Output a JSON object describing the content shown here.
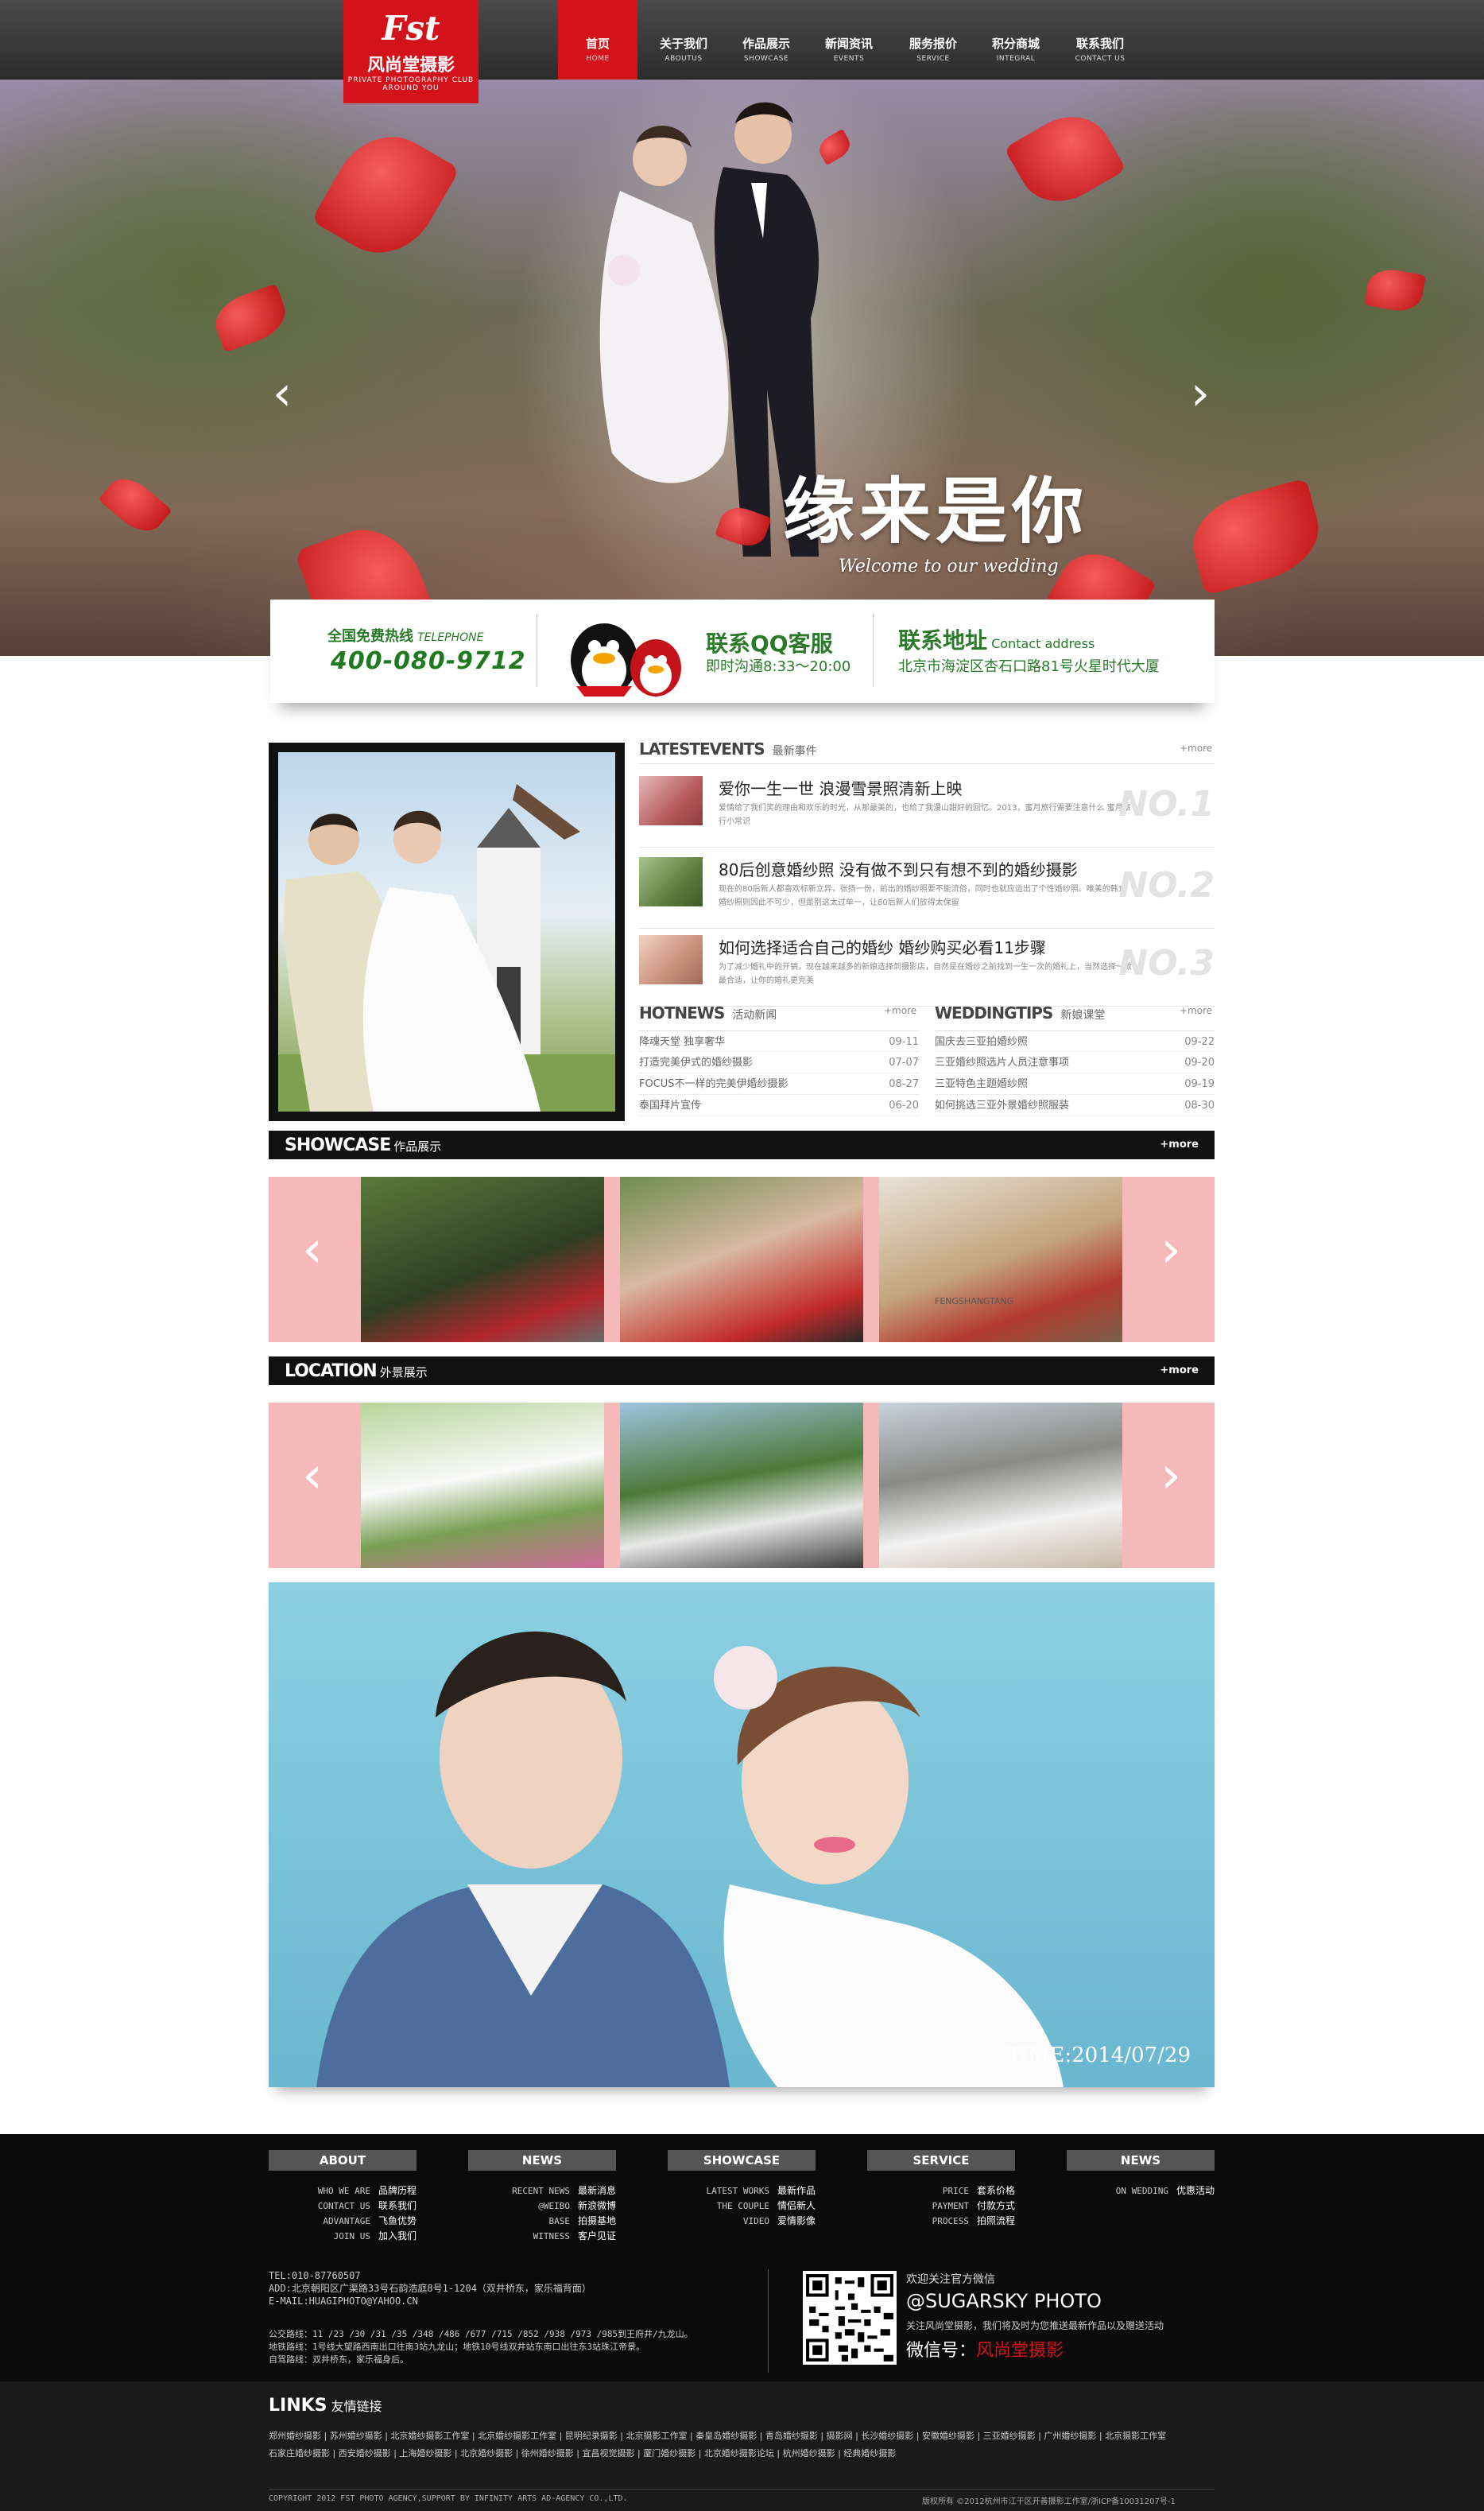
{
  "logo": {
    "brand": "Fst",
    "name": "风尚堂摄影",
    "tag1": "PRIVATE PHOTOGRAPHY CLUB",
    "tag2": "AROUND YOU"
  },
  "nav": [
    {
      "cn": "首页",
      "en": "HOME"
    },
    {
      "cn": "关于我们",
      "en": "ABOUTUS"
    },
    {
      "cn": "作品展示",
      "en": "SHOWCASE"
    },
    {
      "cn": "新闻资讯",
      "en": "EVENTS"
    },
    {
      "cn": "服务报价",
      "en": "SERVICE"
    },
    {
      "cn": "积分商城",
      "en": "INTEGRAL"
    },
    {
      "cn": "联系我们",
      "en": "CONTACT US"
    }
  ],
  "hero": {
    "script": "缘来是你",
    "sub": "Welcome to our wedding",
    "prev": "‹",
    "next": "›"
  },
  "contact": {
    "hotline_title": "全国免费热线",
    "hotline_en": "TELEPHONE",
    "phone": "400-080-9712",
    "qq_title": "联系QQ客服",
    "qq_hours": "即时沟通8:33～20:00",
    "addr_title": "联系地址",
    "addr_en": "Contact address",
    "addr": "北京市海淀区杏石口路81号火星时代大厦"
  },
  "latest": {
    "title": "LATESTEVENTS",
    "sub": "最新事件",
    "more": "+more",
    "items": [
      {
        "t": "爱你一生一世 浪漫雪景照清新上映",
        "d": "爱情给了我们笑的理由和欢乐的时光，从那最美的，也给了我漫山甜好的回忆。2013，蜜月旅行需要注意什么 蜜月旅行小常识",
        "no": "NO.1"
      },
      {
        "t": "80后创意婚纱照 没有做不到只有想不到的婚纱摄影",
        "d": "现在的80后新人都喜欢标新立异，张扬一份，前出的婚纱照要不能流俗，同时也就应运出了个性婚纱照。唯美的韩式婚纱照则因此不可少，但是别这太过单一，让80后新人们放得太保留",
        "no": "NO.2"
      },
      {
        "t": "如何选择适合自己的婚纱 婚纱购买必看11步骤",
        "d": "为了减少婚礼中的开销，现在越来越多的新娘选择到摄影店，自然是在婚纱之前找到一生一次的婚礼上，当然选择一款最合适，让你的婚礼更完美",
        "no": "NO.3"
      }
    ]
  },
  "hotnews": {
    "title": "HOTNEWS",
    "sub": "活动新闻",
    "more": "+more",
    "rows": [
      {
        "t": "降魂天堂 独享奢华",
        "d": "09-11"
      },
      {
        "t": "打造完美伊式的婚纱摄影",
        "d": "07-07"
      },
      {
        "t": "FOCUS不一样的完美伊婚纱摄影",
        "d": "08-27"
      },
      {
        "t": "泰国拜片宣传",
        "d": "06-20"
      }
    ]
  },
  "tips": {
    "title": "WEDDINGTIPS",
    "sub": "新娘课堂",
    "more": "+more",
    "rows": [
      {
        "t": "国庆去三亚拍婚纱照",
        "d": "09-22"
      },
      {
        "t": "三亚婚纱照选片人员注意事项",
        "d": "09-20"
      },
      {
        "t": "三亚特色主题婚纱照",
        "d": "09-19"
      },
      {
        "t": "如何挑选三亚外景婚纱照服装",
        "d": "08-30"
      }
    ]
  },
  "showcase": {
    "title": "SHOWCASE",
    "sub": "作品展示",
    "more": "+more",
    "prev": "‹",
    "next": "›",
    "caption": "FENGSHANGTANG"
  },
  "location": {
    "title": "LOCATION",
    "sub": "外景展示",
    "more": "+more",
    "prev": "‹",
    "next": "›"
  },
  "bigphoto": {
    "time": "TIME:2014/07/29"
  },
  "footer": {
    "heads": [
      "ABOUT",
      "NEWS",
      "SHOWCASE",
      "SERVICE",
      "NEWS"
    ],
    "cols": [
      [
        [
          "WHO WE ARE",
          "品牌历程"
        ],
        [
          "CONTACT US",
          "联系我们"
        ],
        [
          "ADVANTAGE",
          "飞鱼优势"
        ],
        [
          "JOIN US",
          "加入我们"
        ]
      ],
      [
        [
          "RECENT NEWS",
          "最新消息"
        ],
        [
          "@WEIBO",
          "新浪微博"
        ],
        [
          "BASE",
          "拍摄基地"
        ],
        [
          "WITNESS",
          "客户见证"
        ]
      ],
      [
        [
          "LATEST WORKS",
          "最新作品"
        ],
        [
          "THE COUPLE",
          "情侣新人"
        ],
        [
          "VIDEO",
          "爱情影像"
        ]
      ],
      [
        [
          "PRICE",
          "套系价格"
        ],
        [
          "PAYMENT",
          "付款方式"
        ],
        [
          "PROCESS",
          "拍照流程"
        ]
      ],
      [
        [
          "ON WEDDING",
          "优惠活动"
        ]
      ]
    ],
    "tel": "TEL:010-87760507",
    "add": "ADD:北京朝阳区广渠路33号石韵浩庭8号1-1204（双井桥东，家乐福背面）",
    "mail": "E-MAIL:HUAGIPHOTO@YAHOO.CN",
    "bus": "公交路线：11 /23 /30 /31 /35 /348 /486 /677 /715 /852 /938 /973 /985到王府井/九龙山。",
    "metro": "地铁路线：1号线大望路西南出口往南3站九龙山；地铁10号线双井站东南口出往东3站珠江帝景。",
    "drive": "自驾路线：双井桥东，家乐福身后。",
    "wx_follow": "欢迎关注官方微信",
    "wx_id": "@SUGARSKY PHOTO",
    "wx_desc": "关注风尚堂摄影，我们将及时为您推送最新作品以及赠送活动",
    "wx_label": "微信号：",
    "wx_name": "风尚堂摄影",
    "links_title": "LINKS",
    "links_sub": "友情链接",
    "links1": "郑州婚纱摄影 | 苏州婚纱摄影 | 北京婚纱摄影工作室 | 北京婚纱摄影工作室 | 昆明纪录摄影 | 北京摄影工作室 | 秦皇岛婚纱摄影 | 青岛婚纱摄影 | 摄影网 | 长沙婚纱摄影 | 安徽婚纱摄影 | 三亚婚纱摄影 | 广州婚纱摄影 | 北京摄影工作室",
    "links2": "石家庄婚纱摄影 | 西安婚纱摄影 | 上海婚纱摄影 | 北京婚纱摄影 | 徐州婚纱摄影 | 宜昌视觉摄影 | 厦门婚纱摄影 | 北京婚纱摄影论坛 | 杭州婚纱摄影 | 经典婚纱摄影",
    "copyright": "COPYRIGHT 2012 FST PHOTO AGENCY,SUPPORT BY INFINITY ARTS AD-AGENCY CO.,LTD.",
    "icp": "版权所有 ©2012杭州市江干区开善摄影工作室/浙ICP备10031207号-1"
  },
  "colors": {
    "brand_red": "#d3121b",
    "green": "#2a7a2a",
    "pink": "#f6b9b9"
  }
}
